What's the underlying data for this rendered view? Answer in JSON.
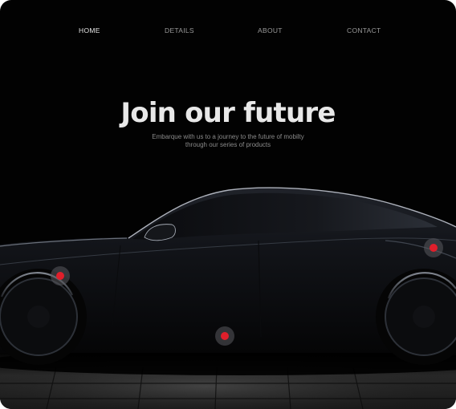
{
  "nav": {
    "items": [
      {
        "label": "HOME",
        "active": true
      },
      {
        "label": "DETAILS",
        "active": false
      },
      {
        "label": "ABOUT",
        "active": false
      },
      {
        "label": "CONTACT",
        "active": false
      }
    ]
  },
  "hero": {
    "title": "Join our future",
    "subtitle_line1": "Embarque with us to a journey to the future of mobilty",
    "subtitle_line2": "through our series of products"
  },
  "hotspots": [
    {
      "name": "hotspot-front-wheel"
    },
    {
      "name": "hotspot-door"
    },
    {
      "name": "hotspot-rear"
    }
  ],
  "colors": {
    "background": "#020202",
    "accent": "#e01f2b",
    "text_primary": "#e8e8e8",
    "text_muted": "#8a8a8a"
  }
}
